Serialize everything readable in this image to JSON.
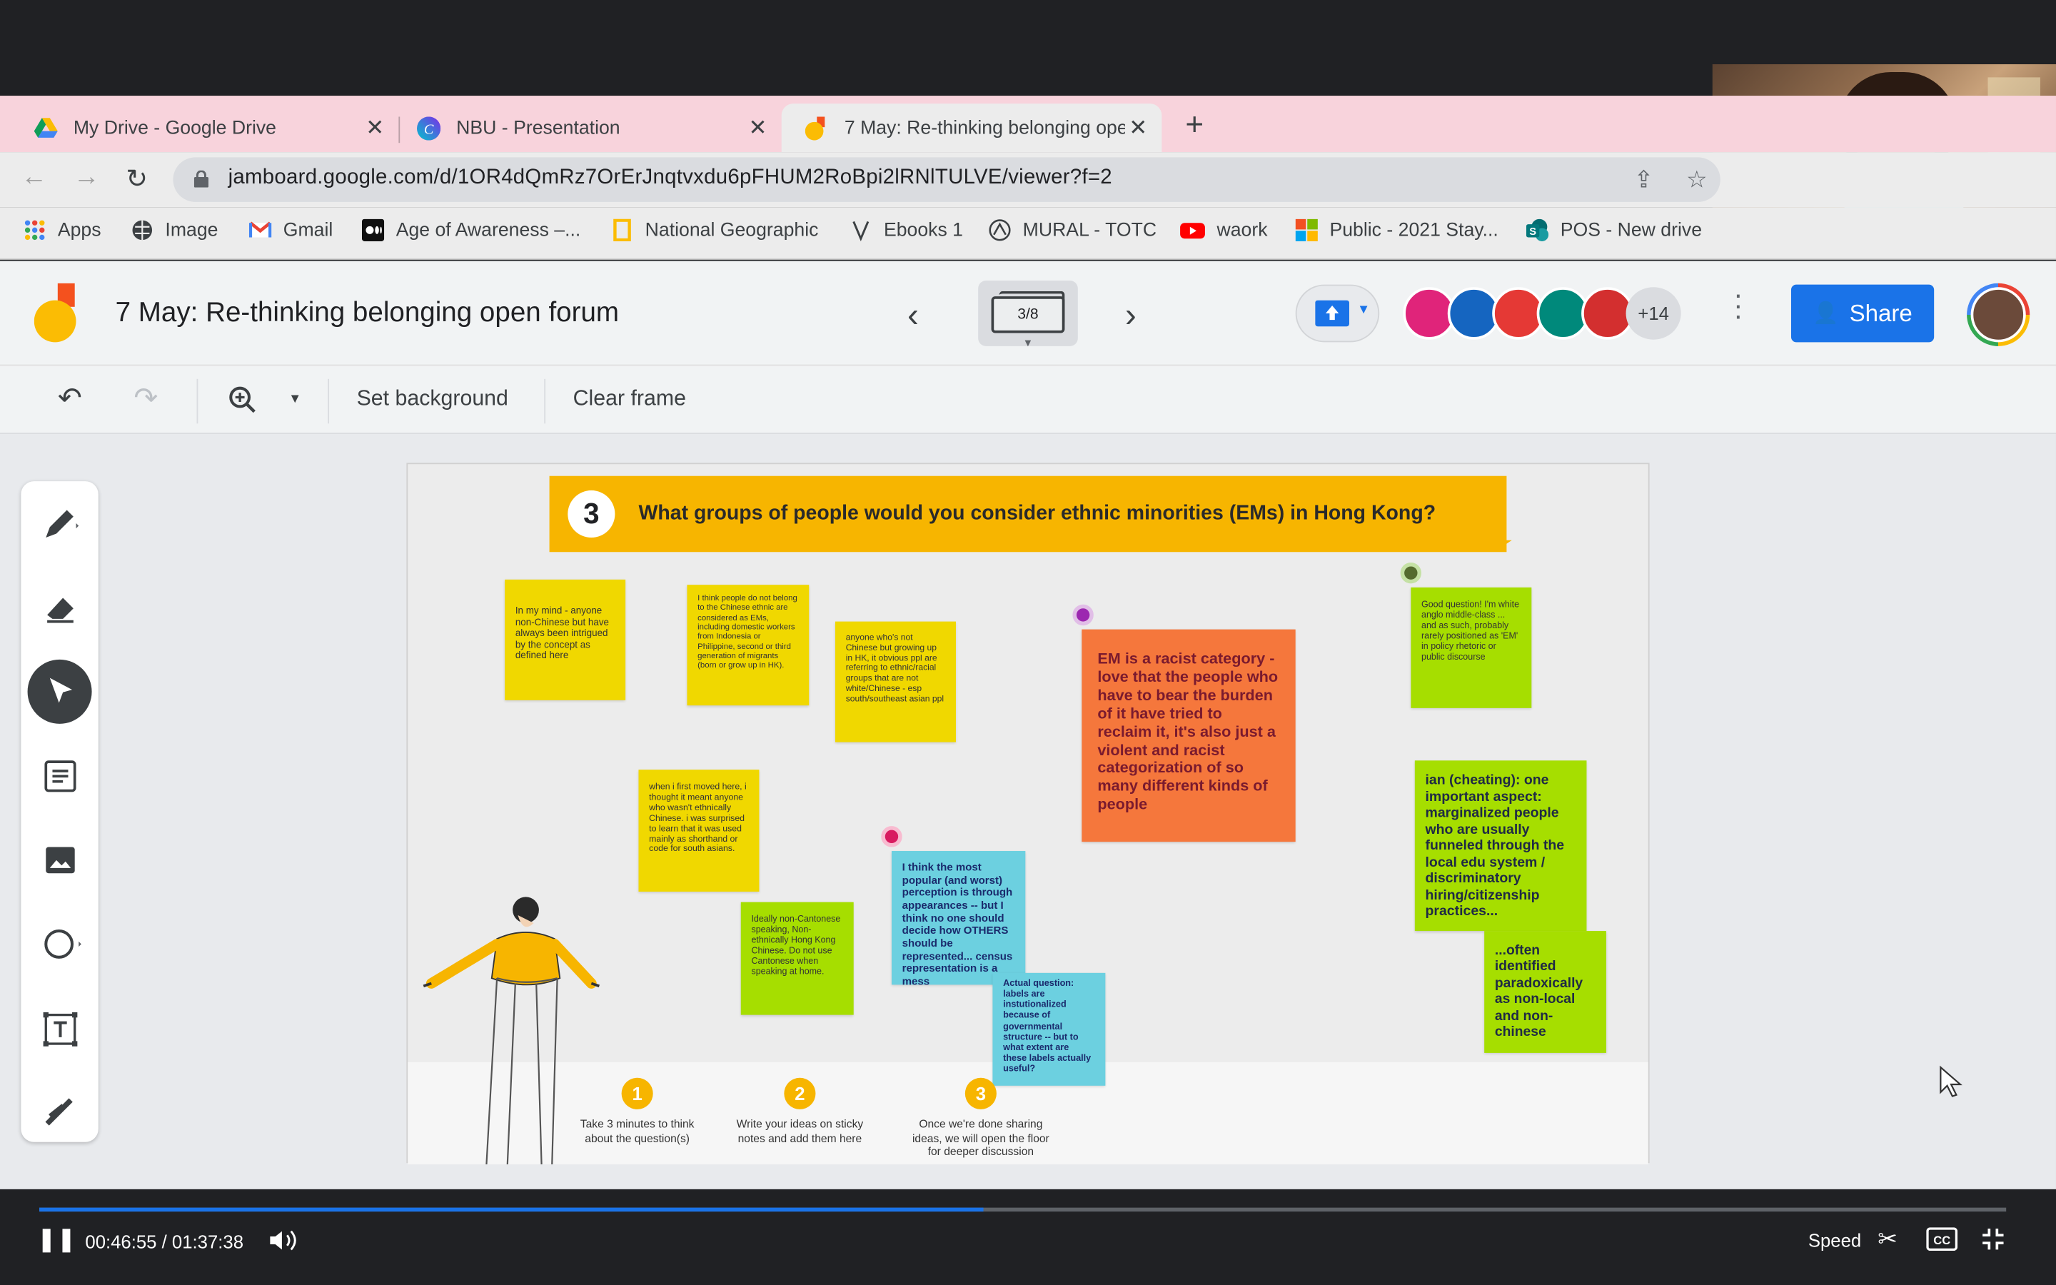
{
  "browser": {
    "tabs": [
      {
        "title": "My Drive - Google Drive",
        "icon": "google-drive-icon"
      },
      {
        "title": "NBU - Presentation",
        "icon": "canva-icon"
      },
      {
        "title": "7 May: Re-thinking belonging open forum",
        "icon": "jamboard-icon"
      }
    ],
    "url": "jamboard.google.com/d/1OR4dQmRz7OrErJnqtvxdu6pFHUM2RoBpi2lRNlTULVE/viewer?f=2",
    "bookmarks": [
      {
        "label": "Apps",
        "icon": "apps-grid-icon"
      },
      {
        "label": "Image",
        "icon": "image-globe-icon"
      },
      {
        "label": "Gmail",
        "icon": "gmail-icon"
      },
      {
        "label": "Age of Awareness –...",
        "icon": "medium-icon"
      },
      {
        "label": "National Geographic",
        "icon": "natgeo-icon"
      },
      {
        "label": "Ebooks 1",
        "icon": "vellum-icon"
      },
      {
        "label": "MURAL - TOTC",
        "icon": "mural-icon"
      },
      {
        "label": "waork",
        "icon": "youtube-icon"
      },
      {
        "label": "Public - 2021 Stay...",
        "icon": "microsoft-icon"
      },
      {
        "label": "POS - New drive",
        "icon": "sharepoint-icon"
      }
    ]
  },
  "jamboard": {
    "title": "7 May: Re-thinking belonging open forum",
    "frame_indicator": "3/8",
    "collaborators_extra": "+14",
    "share_label": "Share",
    "toolbar": {
      "set_background": "Set background",
      "clear_frame": "Clear frame"
    }
  },
  "frame": {
    "question_number": "3",
    "question": "What groups of people would you consider ethnic minorities (EMs) in Hong Kong?",
    "notes": [
      "In my mind - anyone non-Chinese but have always been intrigued by the concept as defined here",
      "I think people do not belong to the Chinese ethnic are considered as EMs, including domestic workers from Indonesia or Philippine, second or third generation of migrants (born or grow up in HK).",
      "anyone who's not Chinese but growing up in HK, it obvious ppl are referring to ethnic/racial groups that are not white/Chinese - esp south/southeast asian ppl",
      "EM is a racist category - love that the people who have to bear the burden of it have tried to reclaim it, it's also just a violent and racist categorization of so many different kinds of people",
      "Good question! I'm white anglo middle-class ... and as such, probably rarely positioned as 'EM' in policy rhetoric or public discourse",
      "when i first moved here, i thought it meant anyone who wasn't ethnically Chinese. i was surprised to learn that it was used mainly as shorthand or code for south asians.",
      "I think the most popular (and worst) perception is through appearances -- but I think no one should decide how OTHERS should be represented... census representation is a mess",
      "ian (cheating): one important aspect: marginalized people who are usually funneled through the local edu system / discriminatory hiring/citizenship practices...",
      "Ideally non-Cantonese speaking, Non-ethnically Hong Kong Chinese.  Do not use Cantonese when speaking at home.",
      "Actual question: labels are instutionalized because of governmental structure -- but to what extent are these labels actually useful?",
      "...often identified paradoxically as non-local and non-chinese"
    ],
    "steps": [
      {
        "n": "1",
        "text": "Take 3 minutes to think about the question(s)"
      },
      {
        "n": "2",
        "text": "Write your ideas on sticky notes and add them here"
      },
      {
        "n": "3",
        "text": "Once we're done sharing ideas, we will open the floor for deeper discussion"
      }
    ]
  },
  "video": {
    "current_time": "00:46:55",
    "separator": " / ",
    "duration": "01:37:38",
    "progress": 0.48,
    "speed_label": "Speed"
  },
  "colors": {
    "accent": "#1a73e8",
    "banner": "#f7b500",
    "sticky_yellow": "#f0d800",
    "sticky_green": "#a6de00",
    "sticky_cyan": "#6cd0e0",
    "sticky_orange": "#f5773c"
  }
}
